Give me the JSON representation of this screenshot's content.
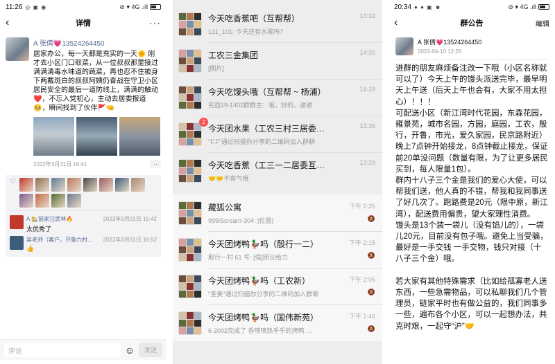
{
  "panel1": {
    "status": {
      "time": "11:26",
      "icons": "◎ ▣ ◉",
      "right": "⊘ ▾ 4G .ıll",
      "battery": 0.6
    },
    "header": {
      "back": "‹",
      "title": "详情",
      "more": "···"
    },
    "post": {
      "author": "A 张倩💗13524264450",
      "text": "居家办公，每一天都是充实的一天🌞\n刚才去小区门口取菜，从一位叔叔那里接过满满清毒水味道的蔬菜，再也忍不住被身下两戴斑白的叔叔阿姨仍奋战在守卫小区居民安全的最后一道防线上，满满的触动❤️，不忘入党初心，主动去居委报道🥺，瞬间找到了伙伴🚩🤜",
      "photos": [
        "photo-1",
        "photo-2",
        "photo-3"
      ],
      "time": "2022年3月31日 16:41",
      "more_btn": "··"
    },
    "likes_icon": "♡",
    "likers_count": 12,
    "comments": [
      {
        "author": "A 🏡链家汪武林🔥",
        "time": "2022年3月31日 15:42",
        "text": "太优秀了"
      },
      {
        "author": "吴老师（客户，开鲁六村…",
        "time": "2022年3月31日 16:52",
        "text": "👍"
      }
    ],
    "input": {
      "placeholder": "评论",
      "emoji": "☺",
      "send": "发送"
    }
  },
  "panel2": {
    "group1": [
      {
        "name": "今天吃香蕉吧（互帮帮）",
        "preview": "131_101: 今天还有水果吗?",
        "time": "14:32",
        "badge": ""
      },
      {
        "name": "工农三金集团",
        "preview": "[图片]",
        "time": "14:30",
        "badge": ""
      },
      {
        "name": "今天吃馒头哦（互帮帮 ~ 杨浦）",
        "preview": "名园19-1402群群主：哦，好的，谢谢",
        "time": "14:29",
        "badge": ""
      },
      {
        "name": "今天团水果（工农三村三居委…",
        "preview": "\"F.F\"通过扫描你分享的二维码加入群聊",
        "time": "13:36",
        "badge": "2"
      },
      {
        "name": "今天吃香蕉（工三一二居委互…",
        "preview": "🤝🤝不客气哦",
        "time": "13:29",
        "badge": ""
      }
    ],
    "group2": [
      {
        "name": "藏狐公寓",
        "preview": "999iScream-304: [位置]",
        "time": "下午 2:35",
        "mute": "🔕"
      },
      {
        "name": "今天团烤鸭🦆吗（殷行一二）",
        "preview": "殷行一村 61 号: [强]团长给力",
        "time": "下午 2:15",
        "mute": "🔕"
      },
      {
        "name": "今天团烤鸭🦆吗（工农新）",
        "preview": "\"圣美\"通过扫描你分享的二维码加入群聊",
        "time": "下午 2:06",
        "mute": "🔕"
      },
      {
        "name": "今天团烤鸭🦆吗（国伟新苑）",
        "preview": "6-2002完成了 香喷喷热乎乎的烤鸭 …",
        "time": "下午 1:46",
        "mute": "🔕"
      }
    ]
  },
  "panel3": {
    "status": {
      "time": "20:34",
      "icons": "● ● ▣ ☻",
      "right": "⊘ ▾ 4G .ıll",
      "battery": 0.7
    },
    "header": {
      "back": "‹",
      "title": "群公告",
      "edit": "编辑"
    },
    "author": "A 张倩💗13524264450",
    "time": "2022-04-10 12:26",
    "body": "进群的朋友麻烦备注改一下哦（小区名称就可以了）今天上午的馒头派送完毕，最早明天上午送（后天上午也会有，大家不用太担心）！！！\n可配送小区（新江湾时代花园，东森花园，雍景苑，城市名园，方园，庭园，工农，殷行，开鲁，市光，爱久家园，民京路附近）晚上7点钟开始接龙，8点钟截止接龙，保证前20单没问题（数量有限，为了让更多居民买到，每人限量1包）。\n群内十八子三个金是我们的爱心大使，可以帮我们送，他人真的不错，帮我和我同事送了好几次了。跑路费是20元（限中原，新江湾），配送费用偏贵，望大家理性消费。\n馒头是13个装一袋儿（没有馅儿的），一袋儿20元，目前没有包子哦。避免上当受骗，最好是一手交钱 一手交物，钱只对接（十八子三个金）哦。\n\n若大家有其他特殊需求（比如给孤寡老人送东西，一些急需物品，可以私聊我们几个管理员，链家平时也有做公益的，我们同事多一些，遍布各个小区，可以一起想办法，共克时艰，一起守“沪”🤝"
  },
  "colors": {
    "link_blue": "#576b95",
    "badge_red": "#fa5151",
    "chat_bg": "#ededed"
  }
}
